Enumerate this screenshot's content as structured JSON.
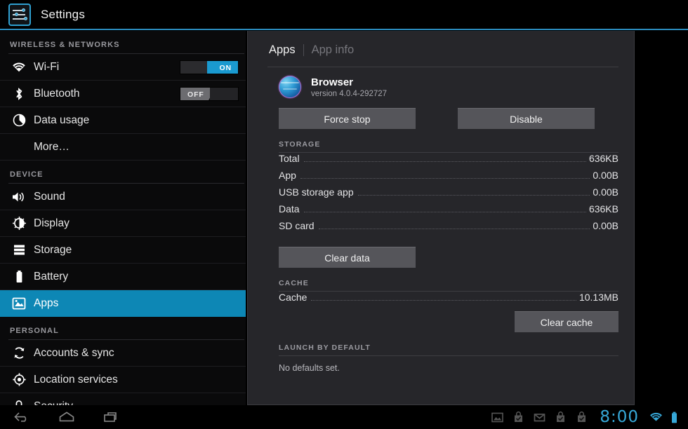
{
  "titlebar": {
    "icon": "settings-sliders-icon",
    "title": "Settings"
  },
  "sidebar": {
    "sections": [
      {
        "header": "WIRELESS & NETWORKS",
        "items": [
          {
            "label": "Wi-Fi",
            "icon": "wifi-icon",
            "toggle": "ON",
            "selected": false
          },
          {
            "label": "Bluetooth",
            "icon": "bluetooth-icon",
            "toggle": "OFF",
            "selected": false
          },
          {
            "label": "Data usage",
            "icon": "data-usage-icon",
            "selected": false
          },
          {
            "label": "More…",
            "icon": null,
            "selected": false
          }
        ]
      },
      {
        "header": "DEVICE",
        "items": [
          {
            "label": "Sound",
            "icon": "sound-icon",
            "selected": false
          },
          {
            "label": "Display",
            "icon": "display-icon",
            "selected": false
          },
          {
            "label": "Storage",
            "icon": "storage-icon",
            "selected": false
          },
          {
            "label": "Battery",
            "icon": "battery-icon",
            "selected": false
          },
          {
            "label": "Apps",
            "icon": "apps-icon",
            "selected": true
          }
        ]
      },
      {
        "header": "PERSONAL",
        "items": [
          {
            "label": "Accounts & sync",
            "icon": "sync-icon",
            "selected": false
          },
          {
            "label": "Location services",
            "icon": "location-icon",
            "selected": false
          },
          {
            "label": "Security",
            "icon": "lock-icon",
            "selected": false
          }
        ]
      }
    ]
  },
  "panel": {
    "breadcrumb": {
      "current": "Apps",
      "next": "App info"
    },
    "app": {
      "icon": "browser-globe-icon",
      "name": "Browser",
      "version": "version 4.0.4-292727"
    },
    "actions": {
      "force_stop": "Force stop",
      "disable": "Disable"
    },
    "storage": {
      "header": "STORAGE",
      "rows": [
        {
          "label": "Total",
          "value": "636KB"
        },
        {
          "label": "App",
          "value": "0.00B"
        },
        {
          "label": "USB storage app",
          "value": "0.00B"
        },
        {
          "label": "Data",
          "value": "636KB"
        },
        {
          "label": "SD card",
          "value": "0.00B"
        }
      ],
      "clear_data": "Clear data"
    },
    "cache": {
      "header": "CACHE",
      "rows": [
        {
          "label": "Cache",
          "value": "10.13MB"
        }
      ],
      "clear_cache": "Clear cache"
    },
    "launch_by_default": {
      "header": "LAUNCH BY DEFAULT",
      "text": "No defaults set."
    }
  },
  "systembar": {
    "nav": [
      {
        "name": "back-button"
      },
      {
        "name": "home-button"
      },
      {
        "name": "recent-apps-button"
      }
    ],
    "notifications": [
      {
        "name": "image-icon"
      },
      {
        "name": "download-bag-icon"
      },
      {
        "name": "gmail-icon"
      },
      {
        "name": "download-bag-icon-2"
      },
      {
        "name": "download-bag-icon-3"
      }
    ],
    "clock": "8:00",
    "wifi": "wifi-icon",
    "battery": "battery-icon"
  },
  "colors": {
    "accent": "#0d87b5",
    "rule": "#2b8cbe",
    "clock": "#37a8d8",
    "panel_bg": "#26262a",
    "button": "#55555a"
  }
}
